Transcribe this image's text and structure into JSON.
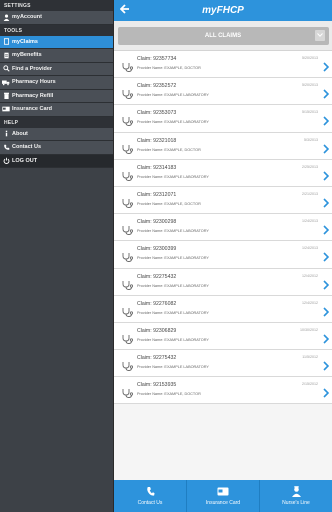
{
  "sidebar": {
    "settings_header": "SETTINGS",
    "tools_header": "TOOLS",
    "help_header": "HELP",
    "items": {
      "myaccount": "myAccount",
      "myclaims": "myClaims",
      "mybenefits": "myBenefits",
      "find_provider": "Find a Provider",
      "pharmacy_hours": "Pharmacy Hours",
      "pharmacy_refill": "Pharmacy Refill",
      "insurance_card": "Insurance Card",
      "about": "About",
      "contact_us": "Contact Us",
      "logout": "LOG OUT"
    }
  },
  "header": {
    "title": "myFHCP",
    "back_icon": "back-arrow-icon"
  },
  "filter": {
    "label": "ALL CLAIMS"
  },
  "claims": [
    {
      "claim": "Claim: 92357734",
      "provider": "Provider Name: EXAMPLE, DOCTOR",
      "date": "5/20/2013"
    },
    {
      "claim": "Claim: 92352572",
      "provider": "Provider Name: EXAMPLE LABORATORY",
      "date": "5/20/2013"
    },
    {
      "claim": "Claim: 92353073",
      "provider": "Provider Name: EXAMPLE LABORATORY",
      "date": "5/15/2013"
    },
    {
      "claim": "Claim: 92321018",
      "provider": "Provider Name: EXAMPLE, DOCTOR",
      "date": "5/3/2013"
    },
    {
      "claim": "Claim: 92314183",
      "provider": "Provider Name: EXAMPLE LABORATORY",
      "date": "2/25/2013"
    },
    {
      "claim": "Claim: 92312071",
      "provider": "Provider Name: EXAMPLE, DOCTOR",
      "date": "2/21/2013"
    },
    {
      "claim": "Claim: 92300298",
      "provider": "Provider Name: EXAMPLE LABORATORY",
      "date": "1/24/2013"
    },
    {
      "claim": "Claim: 92300399",
      "provider": "Provider Name: EXAMPLE LABORATORY",
      "date": "1/24/2013"
    },
    {
      "claim": "Claim: 92275432",
      "provider": "Provider Name: EXAMPLE LABORATORY",
      "date": "12/4/2012"
    },
    {
      "claim": "Claim: 92276082",
      "provider": "Provider Name: EXAMPLE LABORATORY",
      "date": "12/4/2012"
    },
    {
      "claim": "Claim: 92306829",
      "provider": "Provider Name: EXAMPLE LABORATORY",
      "date": "10/30/2012"
    },
    {
      "claim": "Claim: 92275432",
      "provider": "Provider Name: EXAMPLE LABORATORY",
      "date": "11/5/2012"
    },
    {
      "claim": "Claim: 92153935",
      "provider": "Provider Name: EXAMPLE, DOCTOR",
      "date": "2/15/2012"
    }
  ],
  "bottom_tabs": {
    "contact": "Contact Us",
    "insurance": "Insurance Card",
    "nurse": "Nurse's Line"
  },
  "colors": {
    "accent": "#2d93dc",
    "sidebar": "#3d4147",
    "active": "#2e8fd8"
  }
}
